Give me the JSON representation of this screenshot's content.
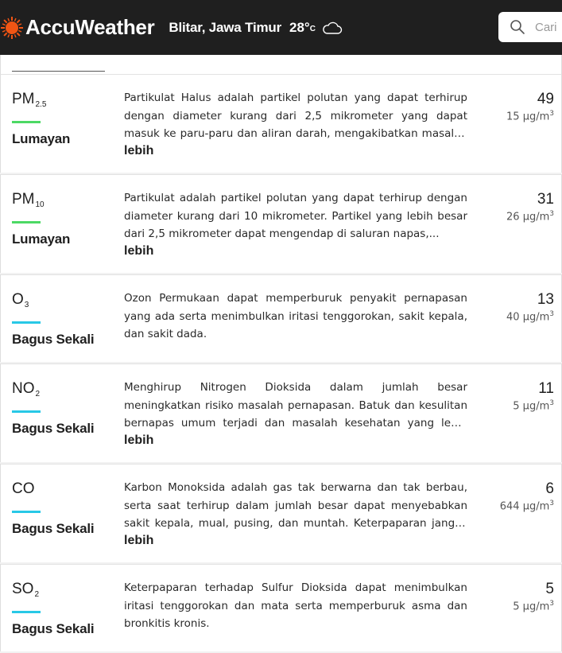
{
  "header": {
    "brand": "AccuWeather",
    "location": "Blitar, Jawa Timur",
    "temperature": "28°",
    "temperature_unit": "C",
    "weather_icon": "cloud-icon",
    "search_placeholder": "Cari"
  },
  "colors": {
    "brand_orange": "#f05514",
    "fair_green": "#4cd964",
    "excellent_cyan": "#28c8e6"
  },
  "more_label": "lebih",
  "pollutants": [
    {
      "name": "PM",
      "sub": "2.5",
      "category": "Lumayan",
      "category_color": "#4cd964",
      "description": "Partikulat Halus adalah partikel polutan yang dapat terhirup dengan diameter kurang dari 2,5 mikrometer yang dapat masuk ke paru-paru dan aliran darah, mengakibatkan masalah kesehatan...",
      "has_more": true,
      "index": "49",
      "concentration": "15 μg/m",
      "concentration_sup": "3"
    },
    {
      "name": "PM",
      "sub": "10",
      "category": "Lumayan",
      "category_color": "#4cd964",
      "description": "Partikulat adalah partikel polutan yang dapat terhirup dengan diameter kurang dari 10 mikrometer. Partikel yang lebih besar dari 2,5 mikrometer dapat mengendap di saluran napas,...",
      "has_more": true,
      "index": "31",
      "concentration": "26 μg/m",
      "concentration_sup": "3"
    },
    {
      "name": "O",
      "sub": "3",
      "category": "Bagus Sekali",
      "category_color": "#28c8e6",
      "description": "Ozon Permukaan dapat memperburuk penyakit pernapasan yang ada serta menimbulkan iritasi tenggorokan, sakit kepala, dan sakit dada.",
      "has_more": false,
      "index": "13",
      "concentration": "40 μg/m",
      "concentration_sup": "3"
    },
    {
      "name": "NO",
      "sub": "2",
      "category": "Bagus Sekali",
      "category_color": "#28c8e6",
      "description": "Menghirup Nitrogen Dioksida dalam jumlah besar meningkatkan risiko masalah pernapasan. Batuk dan kesulitan bernapas umum terjadi dan masalah kesehatan yang lebih serius seperti infeksi...",
      "has_more": true,
      "index": "11",
      "concentration": "5 μg/m",
      "concentration_sup": "3"
    },
    {
      "name": "CO",
      "sub": "",
      "category": "Bagus Sekali",
      "category_color": "#28c8e6",
      "description": "Karbon Monoksida adalah gas tak berwarna dan tak berbau, serta saat terhirup dalam jumlah besar dapat menyebabkan sakit kepala, mual, pusing, dan muntah. Keterpaparan jangka panjang...",
      "has_more": true,
      "index": "6",
      "concentration": "644 μg/m",
      "concentration_sup": "3"
    },
    {
      "name": "SO",
      "sub": "2",
      "category": "Bagus Sekali",
      "category_color": "#28c8e6",
      "description": "Keterpaparan terhadap Sulfur Dioksida dapat menimbulkan iritasi tenggorokan dan mata serta memperburuk asma dan bronkitis kronis.",
      "has_more": false,
      "index": "5",
      "concentration": "5 μg/m",
      "concentration_sup": "3"
    }
  ]
}
